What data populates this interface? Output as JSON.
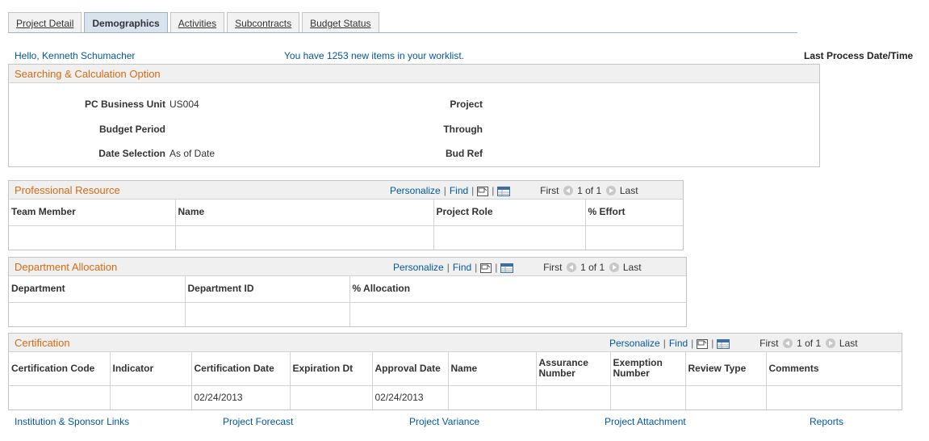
{
  "tabs": [
    {
      "label": "Project Detail"
    },
    {
      "label": "Demographics"
    },
    {
      "label": "Activities"
    },
    {
      "label": "Subcontracts"
    },
    {
      "label": "Budget Status"
    }
  ],
  "header": {
    "greeting": "Hello, Kenneth  Schumacher",
    "worklist": "You have 1253 new items in your worklist.",
    "last_process": "Last Process Date/Time"
  },
  "search_section": {
    "title": "Searching & Calculation Option",
    "pc_business_unit_label": "PC Business Unit",
    "pc_business_unit_value": "US004",
    "budget_period_label": "Budget Period",
    "date_selection_label": "Date Selection",
    "date_selection_value": "As of Date",
    "project_label": "Project",
    "through_label": "Through",
    "bud_ref_label": "Bud Ref"
  },
  "grid_nav": {
    "personalize": "Personalize",
    "find": "Find",
    "first": "First",
    "count": "1 of 1",
    "last": "Last"
  },
  "professional_resource": {
    "title": "Professional Resource",
    "columns": [
      "Team Member",
      "Name",
      "Project Role",
      "% Effort"
    ]
  },
  "department_allocation": {
    "title": "Department Allocation",
    "columns": [
      "Department",
      "Department ID",
      "% Allocation"
    ]
  },
  "certification": {
    "title": "Certification",
    "columns": [
      "Certification Code",
      "Indicator",
      "Certification Date",
      "Expiration Dt",
      "Approval Date",
      "Name",
      "Assurance Number",
      "Exemption Number",
      "Review Type",
      "Comments"
    ],
    "row": {
      "certification_date": "02/24/2013",
      "approval_date": "02/24/2013"
    }
  },
  "bottom_links": [
    "Institution & Sponsor Links",
    "Project Forecast",
    "Project Variance",
    "Project Attachment",
    "Reports"
  ]
}
